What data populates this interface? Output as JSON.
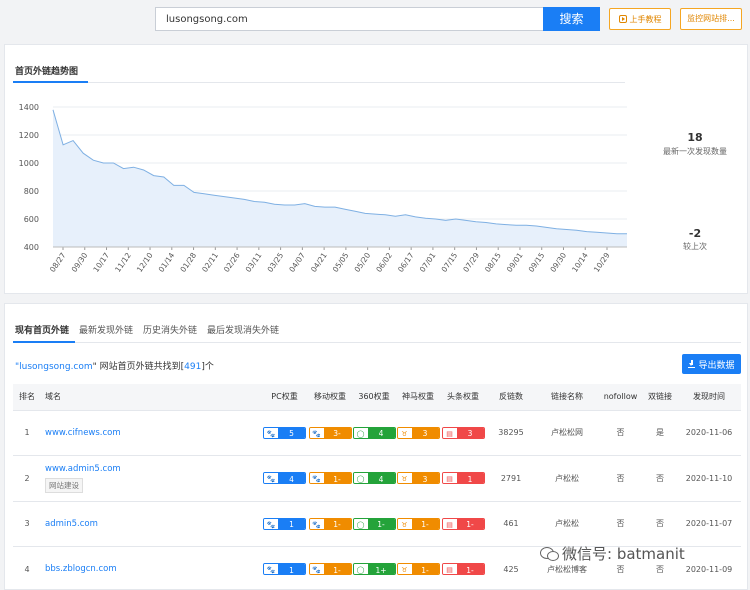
{
  "search": {
    "value": "lusongsong.com",
    "button_label": "搜索"
  },
  "tutorial_label": "上手教程",
  "monitor_label": "监控网站排...",
  "trend": {
    "title": "首页外链趋势图",
    "latest_count": "18",
    "latest_count_label": "最新一次发现数量",
    "change": "-2",
    "change_label": "较上次"
  },
  "chart_data": {
    "type": "area",
    "title": "首页外链趋势图",
    "xlabel": "",
    "ylabel": "",
    "ylim": [
      400,
      1400
    ],
    "yticks": [
      400,
      600,
      800,
      1000,
      1200,
      1400
    ],
    "x_tick_labels": [
      "08/27",
      "09/30",
      "10/17",
      "11/12",
      "12/10",
      "01/14",
      "01/28",
      "02/11",
      "02/26",
      "03/11",
      "03/25",
      "04/07",
      "04/21",
      "05/05",
      "05/20",
      "06/02",
      "06/17",
      "07/01",
      "07/15",
      "07/29",
      "08/15",
      "09/01",
      "09/15",
      "09/30",
      "10/14",
      "10/29"
    ],
    "values": [
      1380,
      1130,
      1160,
      1070,
      1020,
      1000,
      1000,
      960,
      970,
      950,
      910,
      900,
      840,
      840,
      790,
      780,
      770,
      760,
      750,
      740,
      725,
      720,
      705,
      700,
      700,
      710,
      690,
      685,
      685,
      670,
      655,
      640,
      635,
      630,
      620,
      630,
      615,
      605,
      600,
      590,
      600,
      590,
      580,
      575,
      565,
      560,
      555,
      555,
      550,
      540,
      530,
      525,
      520,
      510,
      505,
      500,
      495,
      495
    ]
  },
  "tabs": [
    {
      "label": "现有首页外链"
    },
    {
      "label": "最新发现外链"
    },
    {
      "label": "历史消失外链"
    },
    {
      "label": "最后发现消失外链"
    }
  ],
  "summary": {
    "prefix": "\"",
    "domain": "lusongsong.com",
    "middle": "\" 网站首页外链共找到[",
    "count": "491",
    "suffix": "]个"
  },
  "export_label": "导出数据",
  "table": {
    "headers": [
      "排名",
      "域名",
      "PC权重",
      "移动权重",
      "360权重",
      "神马权重",
      "头条权重",
      "反链数",
      "链接名称",
      "nofollow",
      "双链接",
      "发现时间"
    ],
    "rows": [
      {
        "rank": "1",
        "domain": "www.cifnews.com",
        "tag": "",
        "pc": "5",
        "mob": "3-",
        "r360": "4",
        "sm": "3",
        "tt": "3",
        "backlinks": "38295",
        "link_name": "卢松松网",
        "nofollow": "否",
        "double": "是",
        "date": "2020-11-06"
      },
      {
        "rank": "2",
        "domain": "www.admin5.com",
        "tag": "网站建设",
        "pc": "4",
        "mob": "1-",
        "r360": "4",
        "sm": "3",
        "tt": "1",
        "backlinks": "2791",
        "link_name": "卢松松",
        "nofollow": "否",
        "double": "否",
        "date": "2020-11-10"
      },
      {
        "rank": "3",
        "domain": "admin5.com",
        "tag": "",
        "pc": "1",
        "mob": "1-",
        "r360": "1-",
        "sm": "1-",
        "tt": "1-",
        "backlinks": "461",
        "link_name": "卢松松",
        "nofollow": "否",
        "double": "否",
        "date": "2020-11-07"
      },
      {
        "rank": "4",
        "domain": "bbs.zblogcn.com",
        "tag": "",
        "pc": "1",
        "mob": "1-",
        "r360": "1+",
        "sm": "1-",
        "tt": "1-",
        "backlinks": "425",
        "link_name": "卢松松博客",
        "nofollow": "否",
        "double": "否",
        "date": "2020-11-09"
      }
    ]
  },
  "watermark": "微信号: batmanit",
  "colors": {
    "accent": "#1a7ef5",
    "orange": "#f08c00",
    "green": "#24a33a",
    "red": "#f04848"
  }
}
